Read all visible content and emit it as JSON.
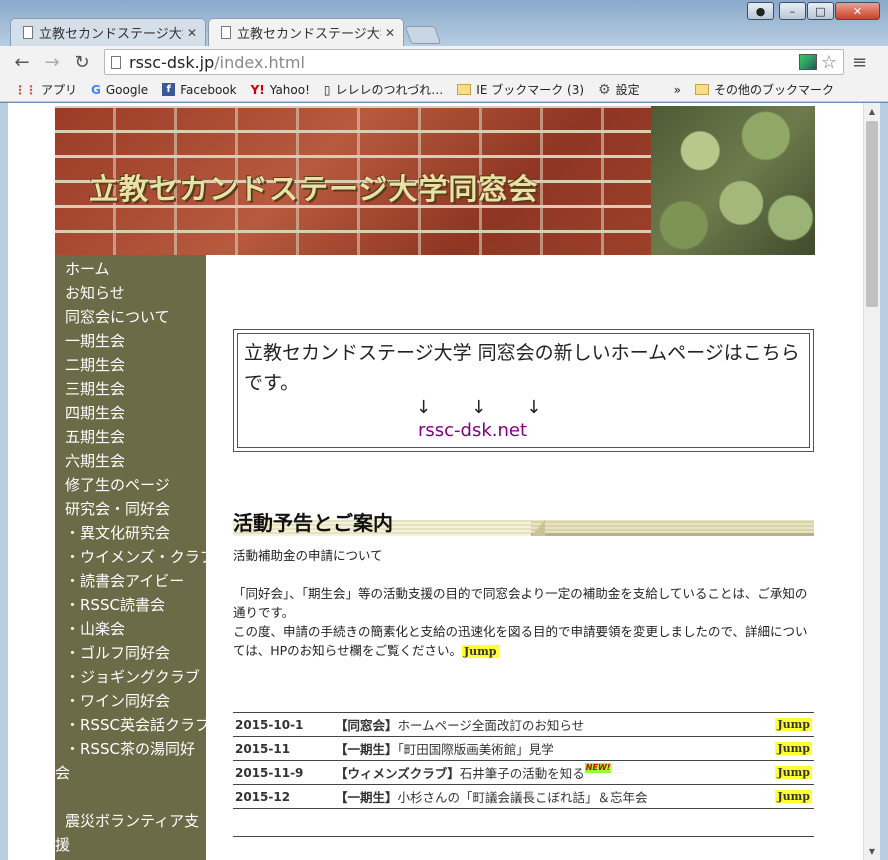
{
  "window": {
    "buttons": [
      "–",
      "□",
      "✕"
    ],
    "user_icon": "user-icon"
  },
  "tabs": [
    {
      "title": "立教セカンドステージ大学",
      "close": "✕"
    },
    {
      "title": "立教セカンドステージ大学",
      "close": "✕"
    }
  ],
  "toolbar": {
    "url_host": "rssc-dsk.jp",
    "url_path": "/index.html",
    "back": "←",
    "forward": "→",
    "reload": "↻",
    "star": "☆",
    "menu": "≡"
  },
  "bookmarks": {
    "items": [
      {
        "label": "アプリ",
        "icon": "apps-icon"
      },
      {
        "label": "Google",
        "icon": "google-icon"
      },
      {
        "label": "Facebook",
        "icon": "facebook-icon"
      },
      {
        "label": "Yahoo!",
        "icon": "yahoo-icon"
      },
      {
        "label": "レレレのつれづれ…",
        "icon": "page-icon"
      },
      {
        "label": "IE ブックマーク (3)",
        "icon": "folder-icon"
      },
      {
        "label": "設定",
        "icon": "gear-icon"
      }
    ],
    "more": "»",
    "other": "その他のブックマーク"
  },
  "banner": {
    "title": "立教セカンドステージ大学同窓会"
  },
  "sidebar": {
    "items": [
      "ホーム",
      "お知らせ",
      "同窓会について",
      "一期生会",
      "二期生会",
      "三期生会",
      "四期生会",
      "五期生会",
      "六期生会",
      "修了生のページ",
      "研究会・同好会",
      "・異文化研究会",
      "・ウイメンズ・クラブ",
      "・読書会アイビー",
      "・RSSC読書会",
      "・山楽会",
      "・ゴルフ同好会",
      "・ジョギングクラブ",
      "・ワイン同好会",
      "・RSSC英会話クラブ",
      "・RSSC茶の湯同好会",
      "震災ボランティア支援"
    ]
  },
  "notice": {
    "text": "立教セカンドステージ大学 同窓会の新しいホームページはこちらです。",
    "arrow": "↓",
    "link": "rssc-dsk.net"
  },
  "section": {
    "title": "活動予告とご案内",
    "line1": "活動補助金の申請について",
    "line2": "「同好会」、「期生会」等の活動支援の目的で同窓会より一定の補助金を支給していることは、ご承知の通りです。",
    "line3": "この度、申請の手続きの簡素化と支給の迅速化を図る目的で申請要領を変更しましたので、詳細については、HPのお知らせ欄をご覧ください。",
    "jump": "Jump"
  },
  "news": [
    {
      "date": "2015-10-1",
      "tag": "【同窓会】",
      "title": "ホームページ全面改訂のお知らせ",
      "new": "",
      "jump": "Jump"
    },
    {
      "date": "2015-11",
      "tag": "【一期生】",
      "title": "「町田国際版画美術館」見学",
      "new": "",
      "jump": "Jump"
    },
    {
      "date": "2015-11-9",
      "tag": "【ウィメンズクラブ】",
      "title": "石井筆子の活動を知る",
      "new": "NEW!",
      "jump": "Jump"
    },
    {
      "date": "2015-12",
      "tag": "【一期生】",
      "title": "小杉さんの「町議会議長こぼれ話」＆忘年会",
      "new": "",
      "jump": "Jump"
    }
  ]
}
